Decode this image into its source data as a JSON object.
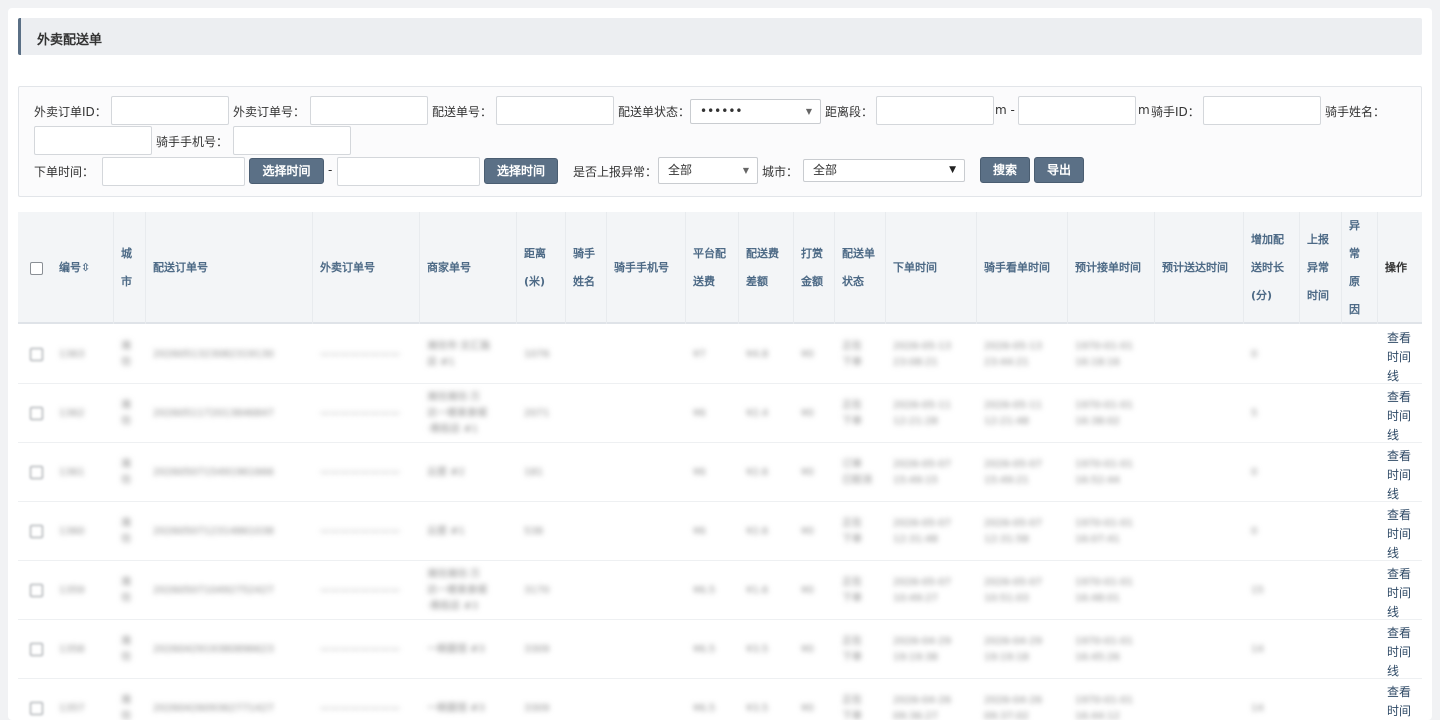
{
  "page_title": "外卖配送单",
  "filters": {
    "takeout_order_id_label": "外卖订单ID：",
    "takeout_order_no_label": "外卖订单号：",
    "delivery_no_label": "配送单号：",
    "delivery_status_label": "配送单状态：",
    "delivery_status_value": "••••••",
    "distance_label": "距离段：",
    "distance_unit_dash": "m -",
    "distance_unit_end": "m",
    "rider_id_label": "骑手ID：",
    "rider_name_label": "骑手姓名：",
    "rider_phone_label": "骑手手机号：",
    "order_time_label": "下单时间：",
    "select_time_label": "选择时间",
    "time_dash": "-",
    "report_exception_label": "是否上报异常：",
    "report_exception_value": "全部",
    "city_label": "城市：",
    "city_value": "全部",
    "search_label": "搜索",
    "export_label": "导出"
  },
  "table": {
    "columns": [
      "编号⇳",
      "城\n市",
      "配送订单号",
      "外卖订单号",
      "商家单号",
      "距离\n(米)",
      "骑手\n姓名",
      "骑手手机号",
      "平台配\n送费",
      "配送费\n差额",
      "打赏\n金额",
      "配送单\n状态",
      "下单时间",
      "骑手看单时间",
      "预计接单时间",
      "预计送达时间",
      "增加配\n送时长\n(分)",
      "上报\n异常\n时间",
      "异\n常\n原\n因",
      "操作"
    ],
    "action_label": "查看\n时间\n线",
    "rows": [
      {
        "id": "1363",
        "city": "潍\n坊",
        "delivery_no": "2026051323082319130",
        "takeout_no": "————————",
        "merchant_no": "潍坊市·文汇路\n店 #1",
        "distance": "1076",
        "platform_fee": "¥7",
        "fee_diff": "¥4.8",
        "tip": "¥0",
        "status": "正在\n下单",
        "order_time": "2026-05-13\n23:08:21",
        "rider_view_time": "2026-05-13\n23:44:21",
        "est_accept_time": "1970-01-01\n16:18:16",
        "add_minutes": "0"
      },
      {
        "id": "1362",
        "city": "潍\n坊",
        "delivery_no": "2026051172013846847",
        "takeout_no": "————————",
        "merchant_no": "潍坊潍坊·万\n达一楼美食城\n·南街店 #1",
        "distance": "2071",
        "platform_fee": "¥6",
        "fee_diff": "¥2.4",
        "tip": "¥0",
        "status": "正在\n下单",
        "order_time": "2026-05-11\n12:21:28",
        "rider_view_time": "2026-05-11\n12:21:48",
        "est_accept_time": "1970-01-01\n16:38:02",
        "add_minutes": "5"
      },
      {
        "id": "1361",
        "city": "潍\n坊",
        "delivery_no": "2026050715491961666",
        "takeout_no": "————————",
        "merchant_no": "云度 #2",
        "distance": "181",
        "platform_fee": "¥6",
        "fee_diff": "¥2.6",
        "tip": "¥0",
        "status": "订单\n已取消",
        "order_time": "2026-05-07\n15:49:15",
        "rider_view_time": "2026-05-07\n15:49:21",
        "est_accept_time": "1970-01-01\n16:52:44",
        "add_minutes": "0"
      },
      {
        "id": "1360",
        "city": "潍\n坊",
        "delivery_no": "2026050712314861038",
        "takeout_no": "————————",
        "merchant_no": "云度 #1",
        "distance": "538",
        "platform_fee": "¥6",
        "fee_diff": "¥2.6",
        "tip": "¥0",
        "status": "正在\n下单",
        "order_time": "2026-05-07\n12:31:48",
        "rider_view_time": "2026-05-07\n12:31:58",
        "est_accept_time": "1970-01-01\n16:07:41",
        "add_minutes": "0"
      },
      {
        "id": "1359",
        "city": "潍\n坊",
        "delivery_no": "2026050710492752427",
        "takeout_no": "————————",
        "merchant_no": "潍坊潍坊·万\n达一楼美食城\n·南街店 #3",
        "distance": "3170",
        "platform_fee": "¥6.5",
        "fee_diff": "¥1.6",
        "tip": "¥0",
        "status": "正在\n下单",
        "order_time": "2026-05-07\n10:49:27",
        "rider_view_time": "2026-05-07\n10:51:03",
        "est_accept_time": "1970-01-01\n16:48:01",
        "add_minutes": "15"
      },
      {
        "id": "1358",
        "city": "潍\n坊",
        "delivery_no": "2026042919380896623",
        "takeout_no": "————————",
        "merchant_no": "一碗面馆 #3",
        "distance": "3309",
        "platform_fee": "¥6.5",
        "fee_diff": "¥3.5",
        "tip": "¥0",
        "status": "正在\n下单",
        "order_time": "2026-04-29\n19:19:38",
        "rider_view_time": "2026-04-29\n19:19:18",
        "est_accept_time": "1970-01-01\n16:45:26",
        "add_minutes": "14"
      },
      {
        "id": "1357",
        "city": "潍\n坊",
        "delivery_no": "2026042609362771427",
        "takeout_no": "————————",
        "merchant_no": "一碗面馆 #3",
        "distance": "3309",
        "platform_fee": "¥6.5",
        "fee_diff": "¥3.5",
        "tip": "¥0",
        "status": "正在\n下单",
        "order_time": "2026-04-26\n09:36:27",
        "rider_view_time": "2026-04-26\n09:37:02",
        "est_accept_time": "1970-01-01\n16:44:12",
        "add_minutes": "14"
      }
    ]
  }
}
